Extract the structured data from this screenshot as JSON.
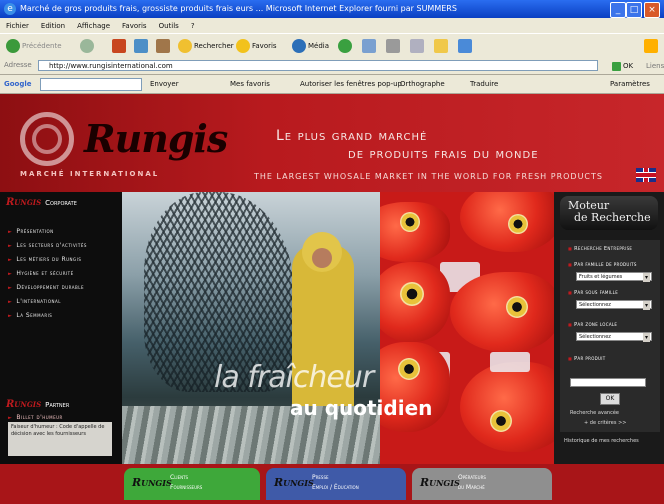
{
  "window": {
    "title": "Marché de gros produits frais, grossiste produits frais eurs ... Microsoft Internet Explorer fourni par SUMMERS"
  },
  "menu": [
    "Fichier",
    "Edition",
    "Affichage",
    "Favoris",
    "Outils",
    "?"
  ],
  "toolbar": {
    "back": "Précédente",
    "search": "Rechercher",
    "favorites": "Favoris",
    "media": "Média"
  },
  "address": {
    "label": "Adresse",
    "url": "http://www.rungisinternational.com",
    "go": "OK",
    "links": "Liens"
  },
  "google_bar": {
    "label": "Google",
    "send": "Envoyer",
    "bookmarks": "Mes favoris",
    "popups": "Autoriser les fenêtres pop-up",
    "spelling": "Orthographe",
    "translate": "Traduire",
    "settings": "Paramètres"
  },
  "banner": {
    "logo": "Rungis",
    "tagline": "MARCHÉ INTERNATIONAL",
    "headline_1": "Le plus grand marché",
    "headline_2": "de produits frais du monde",
    "subline": "THE LARGEST WHOSALE MARKET IN THE WORLD FOR FRESH PRODUCTS"
  },
  "left_nav": {
    "corporate_logo": "Rungis",
    "corporate_label": "Corporate",
    "items": [
      "Présentation",
      "Les secteurs d'activités",
      "Les métiers du Rungis",
      "Hygiène et sécurité",
      "Développement durable",
      "L'international",
      "La Semmaris"
    ],
    "partner_logo": "Rungis",
    "partner_label": "Partner",
    "billet_label": "Billet d'humeur",
    "billet_text": "Faiseur d'humeur : Code d'appelle de décision avec les fournisseurs"
  },
  "hero": {
    "slogan_1": "la fraîcheur",
    "slogan_2": "au quotidien"
  },
  "search_panel": {
    "title_1": "Moteur",
    "title_2": "de Recherche",
    "heading": "Recherche Entreprise",
    "label_family": "Par famille de produits",
    "family_value": "Fruits et légumes",
    "label_subfamily": "Par sous famille",
    "subfamily_value": "Sélectionnez",
    "label_zone": "Par zone locale",
    "zone_value": "Sélectionnez",
    "label_product": "Par produit",
    "ok": "OK",
    "advanced": "Recherche avancée",
    "criteria": "+ de critères >>",
    "history": "Historique de mes recherches"
  },
  "footer_tabs": [
    {
      "logo": "Rungis",
      "line1": "Clients",
      "line2": "Fournisseurs",
      "color": "#3ea83a"
    },
    {
      "logo": "Rungis",
      "line1": "Presse",
      "line2": "Emploi / Éducation",
      "color": "#3f5aa8"
    },
    {
      "logo": "Rungis",
      "line1": "Opérateurs",
      "line2": "du Marché",
      "color": "#8f8f8f"
    }
  ]
}
